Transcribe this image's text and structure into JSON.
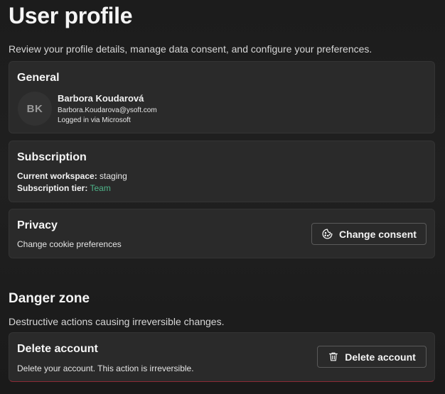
{
  "page": {
    "title": "User profile",
    "subtitle": "Review your profile details, manage data consent, and configure your preferences."
  },
  "general": {
    "title": "General",
    "avatar_initials": "BK",
    "name": "Barbora Koudarová",
    "email": "Barbora.Koudarova@ysoft.com",
    "login_method": "Logged in via Microsoft"
  },
  "subscription": {
    "title": "Subscription",
    "workspace_label": "Current workspace:",
    "workspace_value": "staging",
    "tier_label": "Subscription tier:",
    "tier_value": "Team"
  },
  "privacy": {
    "title": "Privacy",
    "description": "Change cookie preferences",
    "button_label": "Change consent",
    "button_icon": "cookie-icon"
  },
  "danger_zone": {
    "title": "Danger zone",
    "description": "Destructive actions causing irreversible changes.",
    "delete": {
      "title": "Delete account",
      "description": "Delete your account. This action is irreversible.",
      "button_label": "Delete account",
      "button_icon": "trash-icon"
    }
  },
  "colors": {
    "background": "#1e1e1e",
    "card": "#2a2a2a",
    "accent_green": "#4fb58a",
    "danger_border": "#8a2a36"
  }
}
